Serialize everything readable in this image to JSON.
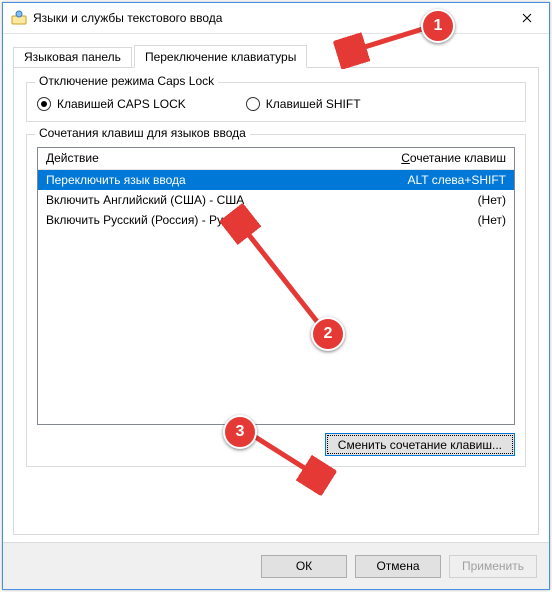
{
  "window": {
    "title": "Языки и службы текстового ввода"
  },
  "tabs": {
    "lang_panel": "Языковая панель",
    "kbd_switch": "Переключение клавиатуры"
  },
  "caps_group": {
    "legend": "Отключение режима Caps Lock",
    "caps_radio": "Клавишей CAPS LOCK",
    "shift_radio": "Клавишей SHIFT"
  },
  "hotkey_group": {
    "legend": "Сочетания клавиш для языков ввода",
    "header_action": "Действие",
    "header_hotkey_pre": "С",
    "header_hotkey_rest": "очетание клавиш",
    "rows": [
      {
        "action": "Переключить язык ввода",
        "hotkey": "ALT слева+SHIFT"
      },
      {
        "action": "Включить Английский (США) - США",
        "hotkey": "(Нет)"
      },
      {
        "action": "Включить Русский (Россия) - Русская",
        "hotkey": "(Нет)"
      }
    ],
    "change_button": "Сменить сочетание клавиш..."
  },
  "buttons": {
    "ok": "ОК",
    "cancel": "Отмена",
    "apply": "Применить"
  },
  "badges": {
    "b1": "1",
    "b2": "2",
    "b3": "3"
  }
}
